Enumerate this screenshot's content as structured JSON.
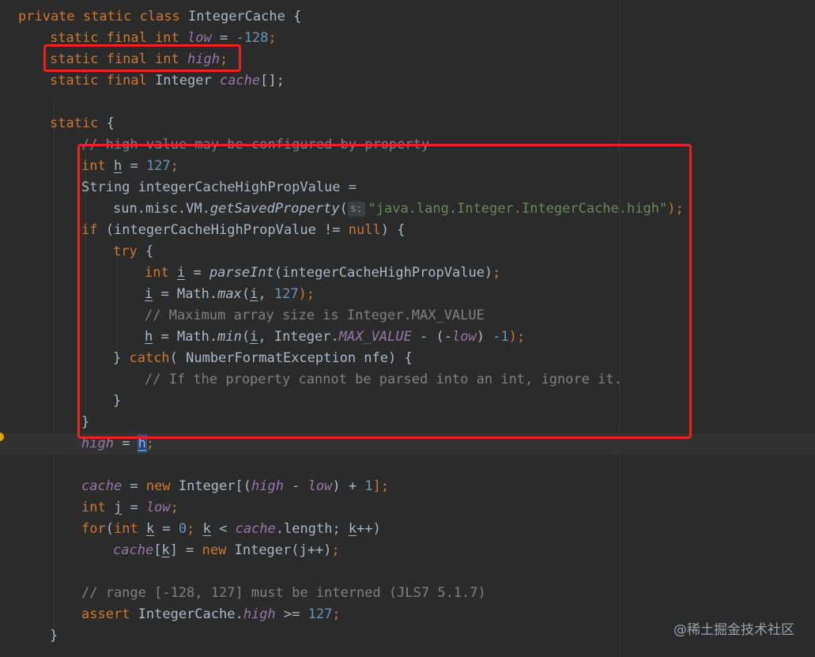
{
  "code": {
    "l1": {
      "kw1": "private",
      "kw2": "static",
      "kw3": "class",
      "name": "IntegerCache",
      "brace": " {"
    },
    "l2": {
      "kw": "static final int",
      "fld": "low",
      "op": " = ",
      "num": "-128",
      "semi": ";"
    },
    "l3": {
      "kw": "static final int",
      "fld": "high",
      "semi": ";"
    },
    "l4": {
      "kw": "static final",
      "type": " Integer ",
      "fld": "cache",
      "rest": "[];"
    },
    "l6": {
      "kw": "static",
      "brace": " {"
    },
    "l7": {
      "cmt": "// high value may be configured by property"
    },
    "l8": {
      "kw": "int",
      "var": "h",
      "op": " = ",
      "num": "127",
      "semi": ";"
    },
    "l9": {
      "text": "String integerCacheHighPropValue ="
    },
    "l10": {
      "pre": "sun.misc.VM.",
      "mth": "getSavedProperty",
      "paren": "(",
      "hint": "s:",
      "str": "\"java.lang.Integer.IntegerCache.high\"",
      "close": ");"
    },
    "l11": {
      "kw": "if",
      "mid": " (integerCacheHighPropValue != ",
      "kw2": "null",
      "close": ") {"
    },
    "l12": {
      "kw": "try",
      "brace": " {"
    },
    "l13": {
      "kw": "int",
      "var": "i",
      "op": " = ",
      "mth": "parseInt",
      "args": "(integerCacheHighPropValue)",
      "semi": ";"
    },
    "l14": {
      "var": "i",
      "mid": " = Math.",
      "mth": "max",
      "p1": "(",
      "var2": "i",
      "comma": ", ",
      "num": "127",
      "close": ");"
    },
    "l15": {
      "cmt": "// Maximum array size is Integer.MAX_VALUE"
    },
    "l16": {
      "var": "h",
      "mid": " = Math.",
      "mth": "min",
      "p1": "(",
      "var2": "i",
      "mid2": ", Integer.",
      "cst": "MAX_VALUE",
      "mid3": " - (-",
      "fld": "low",
      "mid4": ") ",
      "num": "-1",
      "close": ");"
    },
    "l17": {
      "close": "} ",
      "kw": "catch",
      "rest": "( NumberFormatException nfe) {"
    },
    "l18": {
      "cmt": "// If the property cannot be parsed into an int, ignore it."
    },
    "l19": {
      "text": "}"
    },
    "l20": {
      "text": "}"
    },
    "l21": {
      "fld": "high",
      "op": " = ",
      "var": "h",
      "semi": ";"
    },
    "l23": {
      "fld": "cache",
      "op": " = ",
      "kw": "new",
      "mid": " Integer[(",
      "fld2": "high",
      "minus": " - ",
      "fld3": "low",
      "plus": ") + ",
      "num": "1",
      "close": "];"
    },
    "l24": {
      "kw": "int",
      "var": "j",
      "op": " = ",
      "fld": "low",
      "semi": ";"
    },
    "l25": {
      "kw": "for",
      "p": "(",
      "kw2": "int",
      "sp": " ",
      "var": "k",
      "op": " = ",
      "num": "0",
      "semi": "; ",
      "var2": "k",
      "lt": " < ",
      "fld": "cache",
      "len": ".length; ",
      "var3": "k",
      "inc": "++)"
    },
    "l26": {
      "fld": "cache",
      "b1": "[",
      "var": "k",
      "b2": "] = ",
      "kw": "new",
      "rest": " Integer(j++)",
      "semi": ";"
    },
    "l28": {
      "cmt": "// range [-128, 127] must be interned (JLS7 5.1.7)"
    },
    "l29": {
      "kw": "assert",
      "mid": " IntegerCache.",
      "fld": "high",
      "op": " >= ",
      "num": "127",
      "semi": ";"
    },
    "l30": {
      "text": "}"
    }
  },
  "watermark": "@稀土掘金技术社区",
  "colors": {
    "keyword": "#cc7832",
    "number": "#6897bb",
    "string": "#6a8759",
    "comment": "#808080",
    "field": "#9876aa",
    "text": "#a9b7c6",
    "highlight_box": "#e4261f"
  }
}
